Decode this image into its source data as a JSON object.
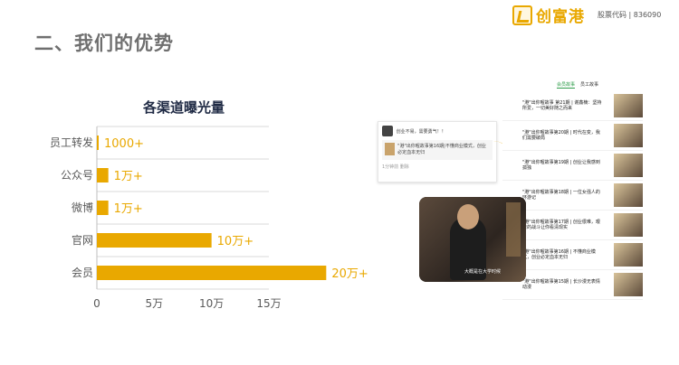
{
  "header": {
    "title": "二、我们的优势",
    "logo_text": "创富港",
    "stock_code": "股票代码 | 836090"
  },
  "colors": {
    "bar": "#e9a800",
    "title": "#6f6f6f"
  },
  "chart_data": {
    "type": "bar",
    "orientation": "horizontal",
    "title": "各渠道曝光量",
    "categories": [
      "员工转发",
      "公众号",
      "微博",
      "官网",
      "会员"
    ],
    "values": [
      1000,
      10000,
      10000,
      100000,
      200000
    ],
    "value_labels": [
      "1000+",
      "1万+",
      "1万+",
      "10万+",
      "20万+"
    ],
    "x_ticks": [
      "0",
      "5万",
      "10万",
      "15万"
    ],
    "x_tick_values": [
      0,
      50000,
      100000,
      150000
    ],
    "xlim": [
      0,
      150000
    ],
    "grid": true
  },
  "collage": {
    "feed_tabs": [
      "会员故事",
      "员工故事"
    ],
    "post_text": "创业不易，需要勇气！！",
    "post_quote": "\"港\"出你喔故事第16期|不懂商业模式，创业必定血本无归",
    "post_meta": "1分钟前  删除",
    "feed_items": [
      "\"港\"出你喔故事 第21期 | 谢鑫楠：坚持所爱，一切美好随之而来",
      "\"港\"出你喔故事第20期 | 时代在变，我们需要破局",
      "\"港\"出你喔故事第19期 | 创业让我感到孤独",
      "\"港\"出你喔故事第18期 | 一位女强人的环游记",
      "\"港\"出你喔故事第17期 | 创业很难，艰苦的战斗让你看清现实",
      "\"港\"出你喔故事第16期 | 不懂商业模式，创业必定血本无归",
      "\"港\"出你喔故事第15期 | 长沙漫无表情动漫"
    ],
    "video_caption": "大概是在大学时候"
  }
}
